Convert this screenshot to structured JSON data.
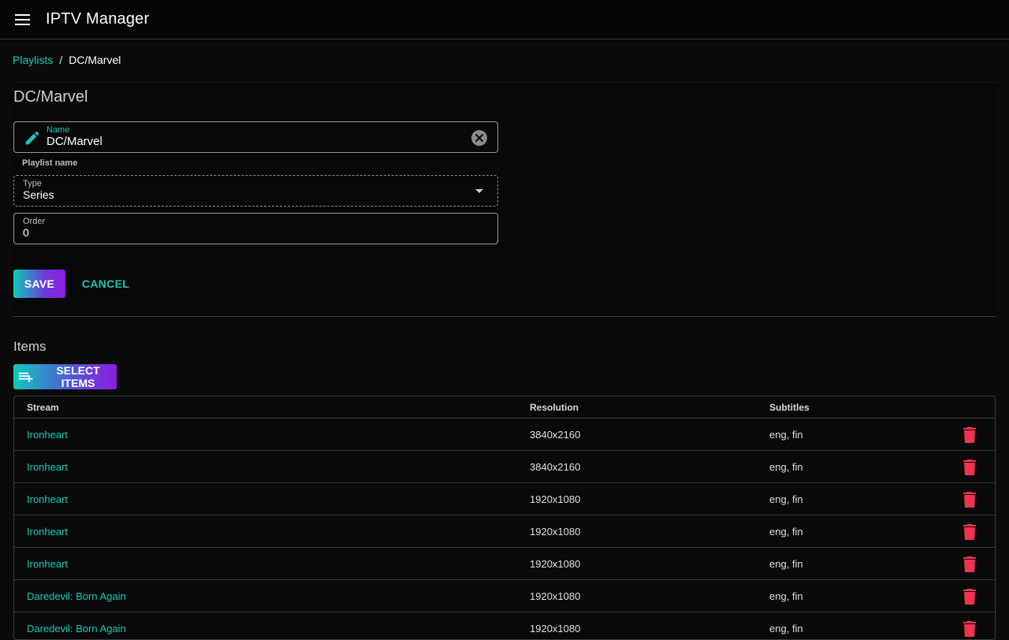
{
  "app": {
    "title": "IPTV Manager"
  },
  "breadcrumb": {
    "parent": "Playlists",
    "separator": "/",
    "current": "DC/Marvel"
  },
  "form": {
    "title": "DC/Marvel",
    "name": {
      "label": "Name",
      "value": "DC/Marvel",
      "hint": "Playlist name"
    },
    "type": {
      "label": "Type",
      "value": "Series"
    },
    "order": {
      "label": "Order",
      "value": "0"
    },
    "save_label": "SAVE",
    "cancel_label": "CANCEL"
  },
  "items": {
    "title": "Items",
    "select_label": "SELECT ITEMS",
    "columns": {
      "stream": "Stream",
      "resolution": "Resolution",
      "subtitles": "Subtitles"
    },
    "rows": [
      {
        "stream": "Ironheart",
        "resolution": "3840x2160",
        "subtitles": "eng, fin"
      },
      {
        "stream": "Ironheart",
        "resolution": "3840x2160",
        "subtitles": "eng, fin"
      },
      {
        "stream": "Ironheart",
        "resolution": "1920x1080",
        "subtitles": "eng, fin"
      },
      {
        "stream": "Ironheart",
        "resolution": "1920x1080",
        "subtitles": "eng, fin"
      },
      {
        "stream": "Ironheart",
        "resolution": "1920x1080",
        "subtitles": "eng, fin"
      },
      {
        "stream": "Daredevil: Born Again",
        "resolution": "1920x1080",
        "subtitles": "eng, fin"
      },
      {
        "stream": "Daredevil: Born Again",
        "resolution": "1920x1080",
        "subtitles": "eng, fin"
      }
    ]
  },
  "colors": {
    "accent": "#19c9b6",
    "danger": "#f0344f",
    "gradient_start": "#12c9bd",
    "gradient_end": "#8d1ee0"
  },
  "icons": {
    "menu": "menu-icon",
    "edit": "pencil-icon",
    "clear": "clear-icon",
    "dropdown": "caret-down-icon",
    "add": "playlist-add-icon",
    "delete": "trash-icon"
  }
}
